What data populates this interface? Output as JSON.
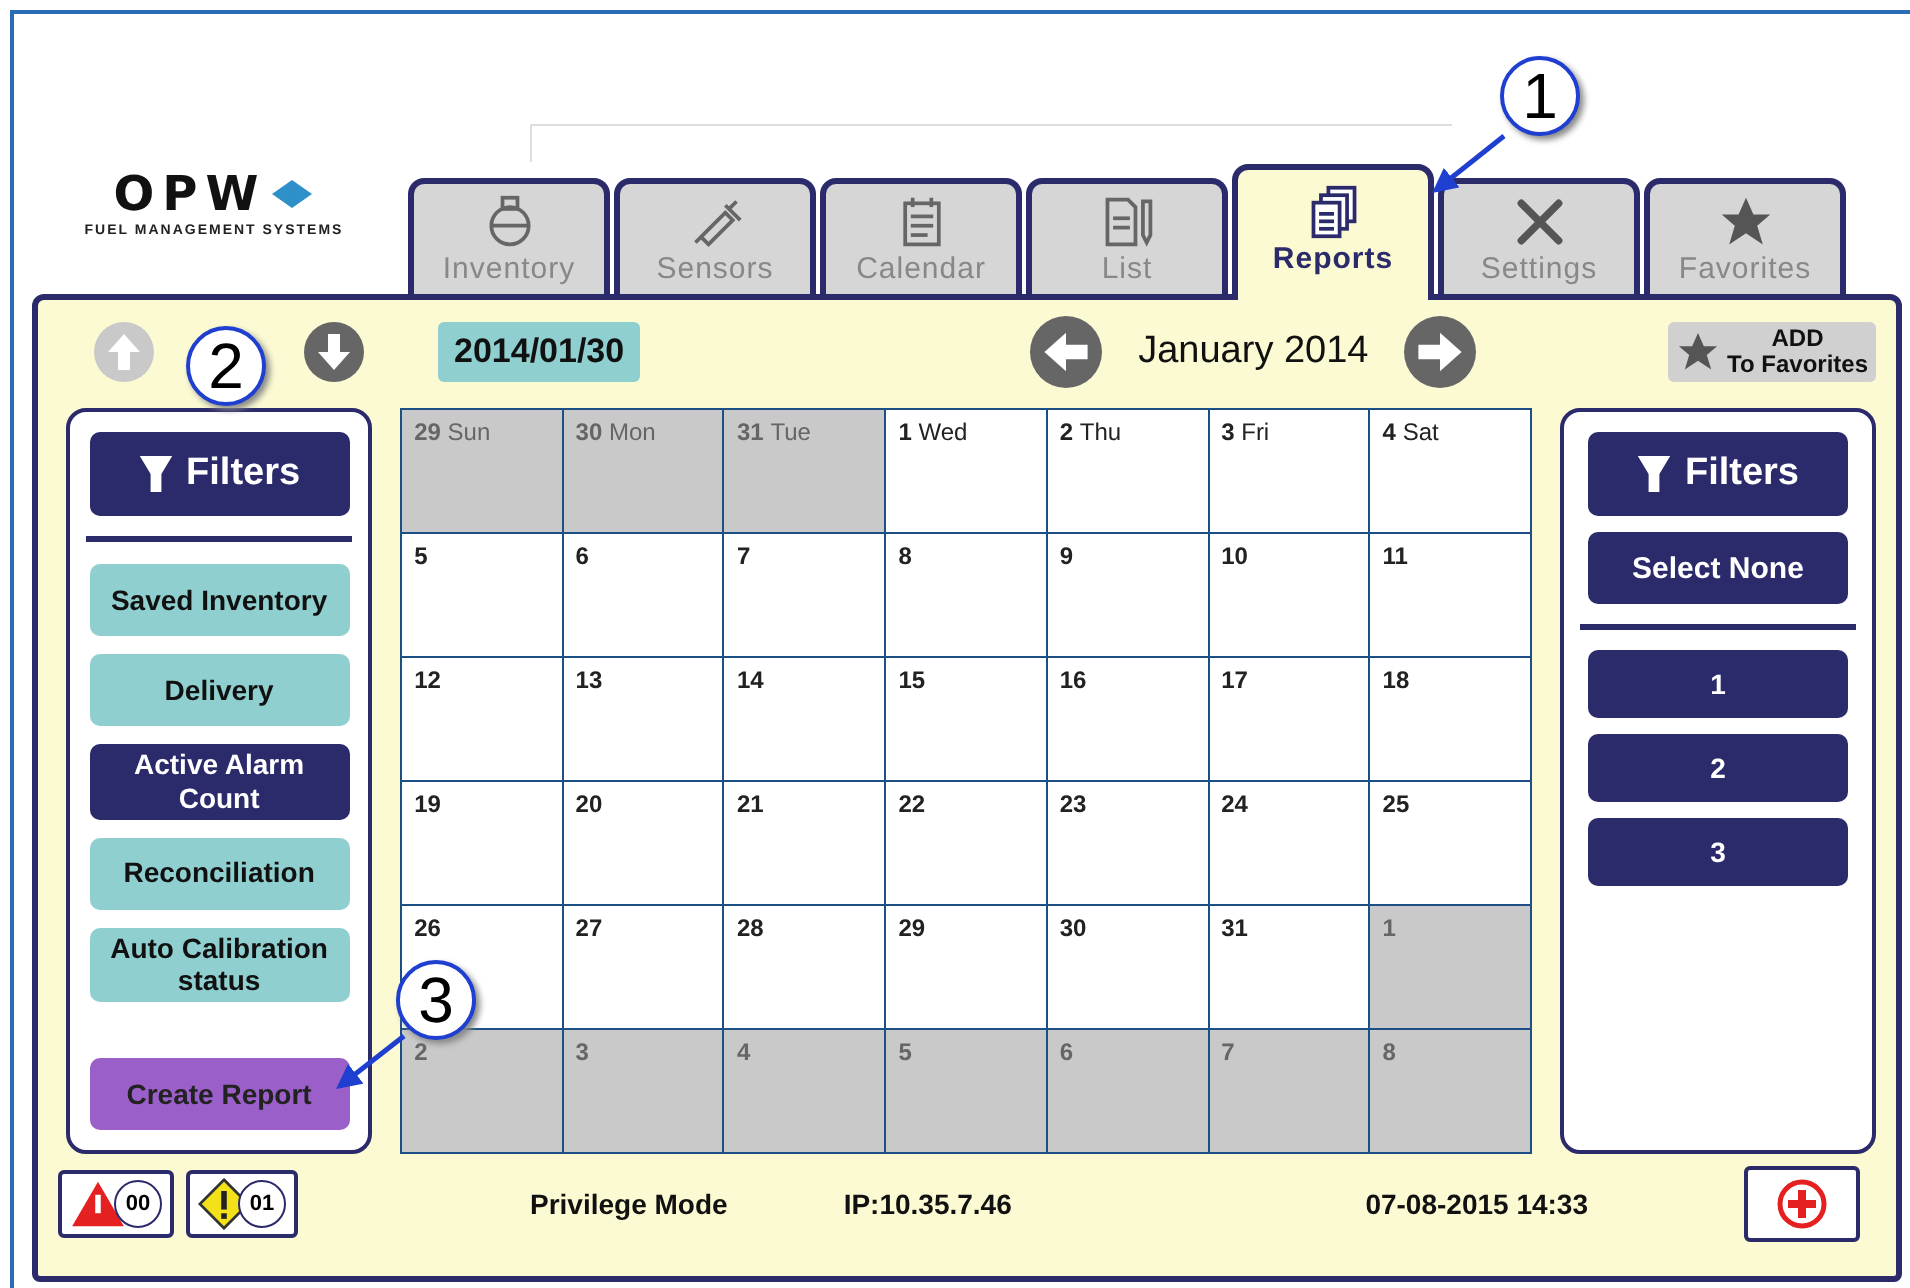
{
  "logo": {
    "name": "OPW",
    "tagline": "FUEL MANAGEMENT SYSTEMS"
  },
  "tabs": [
    {
      "label": "Inventory",
      "selected": false
    },
    {
      "label": "Sensors",
      "selected": false
    },
    {
      "label": "Calendar",
      "selected": false
    },
    {
      "label": "List",
      "selected": false
    },
    {
      "label": "Reports",
      "selected": true
    },
    {
      "label": "Settings",
      "selected": false
    },
    {
      "label": "Favorites",
      "selected": false
    }
  ],
  "nav": {
    "up_disabled": true,
    "down_disabled": false,
    "date": "2014/01/30",
    "month": "January 2014",
    "favorites": {
      "line1": "ADD",
      "line2": "To Favorites"
    }
  },
  "left_filters": {
    "title": "Filters",
    "items": [
      {
        "label": "Saved Inventory",
        "selected": false
      },
      {
        "label": "Delivery",
        "selected": false
      },
      {
        "label": "Active Alarm Count",
        "selected": true
      },
      {
        "label": "Reconciliation",
        "selected": false
      },
      {
        "label": "Auto Calibration status",
        "selected": false
      }
    ],
    "action": "Create Report"
  },
  "calendar": {
    "weeks": [
      [
        {
          "day": "29",
          "weekday": "Sun",
          "in_month": false
        },
        {
          "day": "30",
          "weekday": "Mon",
          "in_month": false
        },
        {
          "day": "31",
          "weekday": "Tue",
          "in_month": false
        },
        {
          "day": "1",
          "weekday": "Wed",
          "in_month": true
        },
        {
          "day": "2",
          "weekday": "Thu",
          "in_month": true
        },
        {
          "day": "3",
          "weekday": "Fri",
          "in_month": true
        },
        {
          "day": "4",
          "weekday": "Sat",
          "in_month": true
        }
      ],
      [
        {
          "day": "5",
          "in_month": true
        },
        {
          "day": "6",
          "in_month": true
        },
        {
          "day": "7",
          "in_month": true
        },
        {
          "day": "8",
          "in_month": true
        },
        {
          "day": "9",
          "in_month": true
        },
        {
          "day": "10",
          "in_month": true
        },
        {
          "day": "11",
          "in_month": true
        }
      ],
      [
        {
          "day": "12",
          "in_month": true
        },
        {
          "day": "13",
          "in_month": true
        },
        {
          "day": "14",
          "in_month": true
        },
        {
          "day": "15",
          "in_month": true
        },
        {
          "day": "16",
          "in_month": true
        },
        {
          "day": "17",
          "in_month": true
        },
        {
          "day": "18",
          "in_month": true
        }
      ],
      [
        {
          "day": "19",
          "in_month": true
        },
        {
          "day": "20",
          "in_month": true
        },
        {
          "day": "21",
          "in_month": true
        },
        {
          "day": "22",
          "in_month": true
        },
        {
          "day": "23",
          "in_month": true
        },
        {
          "day": "24",
          "in_month": true
        },
        {
          "day": "25",
          "in_month": true
        }
      ],
      [
        {
          "day": "26",
          "in_month": true
        },
        {
          "day": "27",
          "in_month": true
        },
        {
          "day": "28",
          "in_month": true
        },
        {
          "day": "29",
          "in_month": true
        },
        {
          "day": "30",
          "in_month": true
        },
        {
          "day": "31",
          "in_month": true
        },
        {
          "day": "1",
          "in_month": false
        }
      ],
      [
        {
          "day": "2",
          "in_month": false
        },
        {
          "day": "3",
          "in_month": false
        },
        {
          "day": "4",
          "in_month": false
        },
        {
          "day": "5",
          "in_month": false
        },
        {
          "day": "6",
          "in_month": false
        },
        {
          "day": "7",
          "in_month": false
        },
        {
          "day": "8",
          "in_month": false
        }
      ]
    ]
  },
  "right_filters": {
    "title": "Filters",
    "select_none": "Select None",
    "items": [
      {
        "label": "1",
        "selected": true
      },
      {
        "label": "2",
        "selected": true
      },
      {
        "label": "3",
        "selected": true
      }
    ]
  },
  "status_bar": {
    "alarm_count": "00",
    "warning_count": "01",
    "mode": "Privilege Mode",
    "ip": "IP:10.35.7.46",
    "datetime": "07-08-2015 14:33"
  },
  "callouts": [
    {
      "label": "1",
      "arrow": true
    },
    {
      "label": "2",
      "arrow": false
    },
    {
      "label": "3",
      "arrow": true
    }
  ]
}
